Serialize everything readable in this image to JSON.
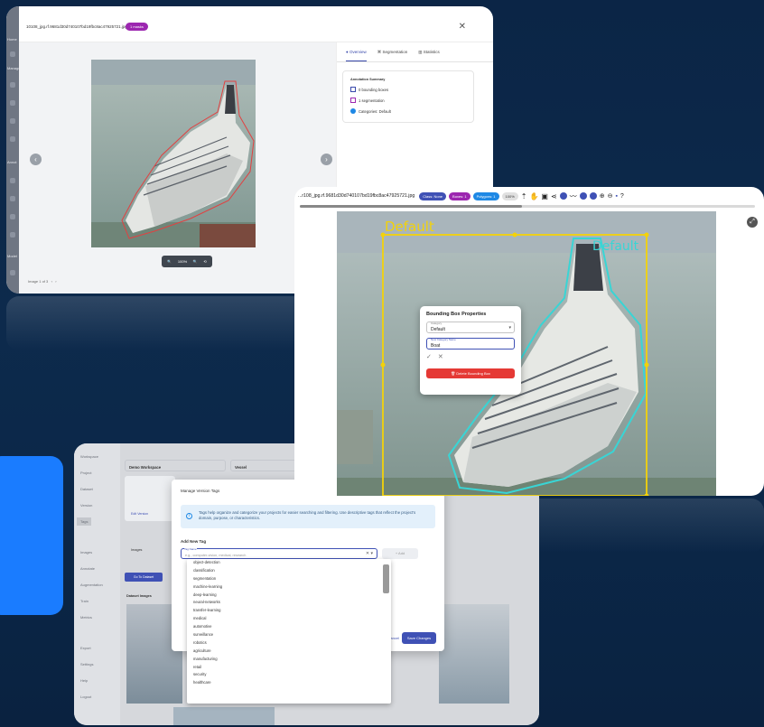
{
  "colors": {
    "background": "#0b2546",
    "accent_blue": "#1a7cff",
    "bbox_yellow": "#f3d20a",
    "mask_cyan": "#39d5d5",
    "primary": "#3f51b5",
    "danger": "#e53935",
    "badge_purple": "#9c27b0"
  },
  "w1": {
    "filename": "10108_jpg.rf.9681d30d740107bd19fbc8ac47925721.jpg",
    "badge": "1 masks",
    "tabs": [
      {
        "label": "Overview",
        "icon": "info-icon"
      },
      {
        "label": "Segmentation",
        "icon": "segment-icon"
      },
      {
        "label": "Statistics",
        "icon": "bar-chart-icon"
      }
    ],
    "summary": {
      "title": "Annotation Summary",
      "rows": [
        "0 bounding boxes",
        "1 segmentation",
        "Categories: Default"
      ]
    },
    "zoom": "100%",
    "image_count": "Image 1 of 3"
  },
  "w2": {
    "filename": "...r108_jpg.rf.9681d30d740107bd19fbc8ac47925721.jpg",
    "chips": [
      "Class: None",
      "Boxes: 1",
      "Polygons: 1"
    ],
    "zoom": "100%",
    "bbox_label": "Default",
    "mask_label": "Default",
    "popup": {
      "title": "Bounding Box Properties",
      "category_label": "Category",
      "category_value": "Default",
      "new_label": "New Category Name",
      "new_value": "Boat",
      "delete": "Delete Bounding Box"
    }
  },
  "w3": {
    "side": [
      "Workspace",
      "Project",
      "Dataset",
      "Version",
      "Tags",
      "Images",
      "Annotate",
      "Augmentation",
      "Train",
      "Metrics",
      "Export",
      "Settings",
      "Help",
      "Logout"
    ],
    "fields": [
      "Demo Workspace",
      "Vessel",
      "Ship model",
      "original"
    ],
    "modal": {
      "title": "Manage Version Tags",
      "info": "Tags help organize and categorize your projects for easier searching and filtering. Use descriptive tags that reflect the project's domain, purpose, or characteristics.",
      "add_title": "Add New Tag",
      "tag_label": "Tag Name",
      "tag_placeholder": "e.g., computer-vision, medical, research",
      "add_btn": "+ Add",
      "cancel": "Cancel",
      "save": "Save Changes"
    },
    "tags": [
      "object-detection",
      "classification",
      "segmentation",
      "machine-learning",
      "deep-learning",
      "neural-networks",
      "transfer-learning",
      "medical",
      "automotive",
      "surveillance",
      "robotics",
      "agriculture",
      "manufacturing",
      "retail",
      "security",
      "healthcare"
    ],
    "bg_labels": {
      "go_dataset": "Go To Dataset",
      "dataset_images": "Dataset Images",
      "images_tab": "Images",
      "edit": "Edit Version"
    }
  }
}
